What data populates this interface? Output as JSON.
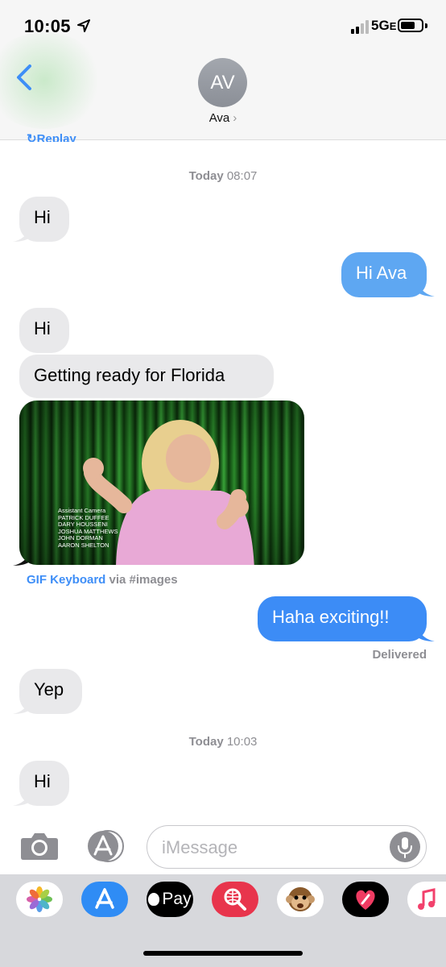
{
  "status_bar": {
    "time": "10:05",
    "network": "5G",
    "network_suffix": "E"
  },
  "header": {
    "avatar_initials": "AV",
    "contact_name": "Ava",
    "replay_label": "Replay"
  },
  "messages": {
    "stamp1_day": "Today",
    "stamp1_time": "08:07",
    "m1": "Hi",
    "m2": "Hi Ava",
    "m3": "Hi",
    "m4": "Getting ready for Florida",
    "gif_credits": [
      "Assistant Camera",
      "PATRICK DUFFEE",
      "DARY HOUSSENI",
      "JOSHUA MATTHEWS",
      "JOHN DORMAN",
      "AARON SHELTON"
    ],
    "via_source": "GIF Keyboard",
    "via_text": "via #images",
    "m5": "Haha exciting!!",
    "delivered": "Delivered",
    "m6": "Yep",
    "stamp2_day": "Today",
    "stamp2_time": "10:03",
    "m7": "Hi"
  },
  "input": {
    "placeholder": "iMessage"
  },
  "drawer": {
    "apple_pay_label": "Pay",
    "apps": [
      "photos-icon",
      "app-store-icon",
      "apple-pay-icon",
      "web-search-icon",
      "animoji-icon",
      "digital-touch-icon",
      "music-icon"
    ]
  },
  "colors": {
    "sent": "#5ea7f2",
    "sent_latest": "#3c8cf6",
    "received": "#e9e9eb",
    "link": "#3e8ef7"
  }
}
